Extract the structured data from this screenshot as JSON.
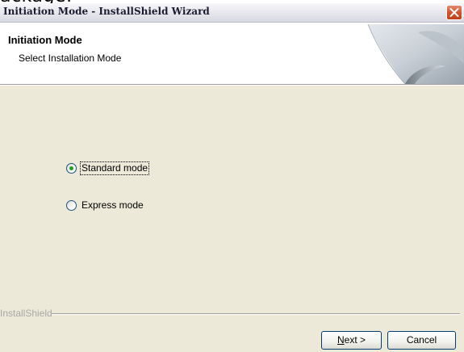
{
  "document_fragment": "ackage:",
  "window": {
    "title": "Initiation Mode - InstallShield Wizard"
  },
  "header": {
    "title": "Initiation Mode",
    "subtitle": "Select Installation Mode"
  },
  "options": [
    {
      "label": "Standard mode",
      "selected": true
    },
    {
      "label": "Express mode",
      "selected": false
    }
  ],
  "footer": {
    "brand": "InstallShield"
  },
  "buttons": {
    "next": {
      "mnemonic": "N",
      "rest": "ext >"
    },
    "cancel": "Cancel"
  },
  "colors": {
    "dialog_background": "#ece9d8",
    "header_background": "#ffffff",
    "close_button": "#d4532d",
    "radio_dot": "#21a121",
    "button_border": "#003c74"
  },
  "icons": {
    "close": "close-icon",
    "header": "wizard-header-graphic"
  }
}
